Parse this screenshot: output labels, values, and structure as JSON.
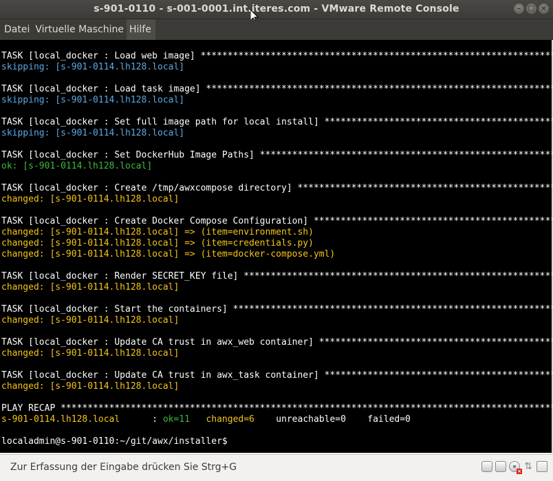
{
  "window": {
    "title": "s-901-0110 - s-001-0001.int.iteres.com - VMware Remote Console",
    "minimize_glyph": "–",
    "maximize_glyph": "□",
    "close_glyph": "×"
  },
  "menu": {
    "items": [
      "Datei",
      "Virtuelle Maschine",
      "Hilfe"
    ]
  },
  "console": {
    "lines": [
      {
        "text": "TASK [local_docker : Load web image] *******************************************************************",
        "color": "white"
      },
      {
        "text": "skipping: [s-901-0114.lh128.local]",
        "color": "skip"
      },
      {
        "text": "",
        "color": "white"
      },
      {
        "text": "TASK [local_docker : Load task image] ******************************************************************",
        "color": "white"
      },
      {
        "text": "skipping: [s-901-0114.lh128.local]",
        "color": "skip"
      },
      {
        "text": "",
        "color": "white"
      },
      {
        "text": "TASK [local_docker : Set full image path for local install] ********************************************",
        "color": "white"
      },
      {
        "text": "skipping: [s-901-0114.lh128.local]",
        "color": "skip"
      },
      {
        "text": "",
        "color": "white"
      },
      {
        "text": "TASK [local_docker : Set DockerHub Image Paths] ********************************************************",
        "color": "white"
      },
      {
        "text": "ok: [s-901-0114.lh128.local]",
        "color": "ok"
      },
      {
        "text": "",
        "color": "white"
      },
      {
        "text": "TASK [local_docker : Create /tmp/awxcompose directory] *************************************************",
        "color": "white"
      },
      {
        "text": "changed: [s-901-0114.lh128.local]",
        "color": "chg"
      },
      {
        "text": "",
        "color": "white"
      },
      {
        "text": "TASK [local_docker : Create Docker Compose Configuration] **********************************************",
        "color": "white"
      },
      {
        "text": "changed: [s-901-0114.lh128.local] => (item=environment.sh)",
        "color": "chg"
      },
      {
        "text": "changed: [s-901-0114.lh128.local] => (item=credentials.py)",
        "color": "chg"
      },
      {
        "text": "changed: [s-901-0114.lh128.local] => (item=docker-compose.yml)",
        "color": "chg"
      },
      {
        "text": "",
        "color": "white"
      },
      {
        "text": "TASK [local_docker : Render SECRET_KEY file] ***********************************************************",
        "color": "white"
      },
      {
        "text": "changed: [s-901-0114.lh128.local]",
        "color": "chg"
      },
      {
        "text": "",
        "color": "white"
      },
      {
        "text": "TASK [local_docker : Start the containers] *************************************************************",
        "color": "white"
      },
      {
        "text": "changed: [s-901-0114.lh128.local]",
        "color": "chg"
      },
      {
        "text": "",
        "color": "white"
      },
      {
        "text": "TASK [local_docker : Update CA trust in awx_web container] **********************************************",
        "color": "white"
      },
      {
        "text": "changed: [s-901-0114.lh128.local]",
        "color": "chg"
      },
      {
        "text": "",
        "color": "white"
      },
      {
        "text": "TASK [local_docker : Update CA trust in awx_task container] *********************************************",
        "color": "white"
      },
      {
        "text": "changed: [s-901-0114.lh128.local]",
        "color": "chg"
      },
      {
        "text": "",
        "color": "white"
      }
    ],
    "recap_header": "PLAY RECAP *********************************************************************************************",
    "recap": {
      "host": "s-901-0114.lh128.local",
      "sep": "      : ",
      "ok": "ok=11",
      "changed": "changed=6",
      "unreachable": "unreachable=0",
      "failed": "failed=0"
    },
    "prompt": "localadmin@s-901-0110:~/git/awx/installer$"
  },
  "statusbar": {
    "text": "Zur Erfassung der Eingabe drücken Sie Strg+G",
    "icons": [
      "hard-disk-icon",
      "hard-disk-icon",
      "cd-drive-icon",
      "network-icon",
      "message-icon"
    ]
  },
  "colors": {
    "white": "#ffffff",
    "skip": "#5aa9e6",
    "ok": "#3fb83f",
    "chg": "#f5c518"
  }
}
